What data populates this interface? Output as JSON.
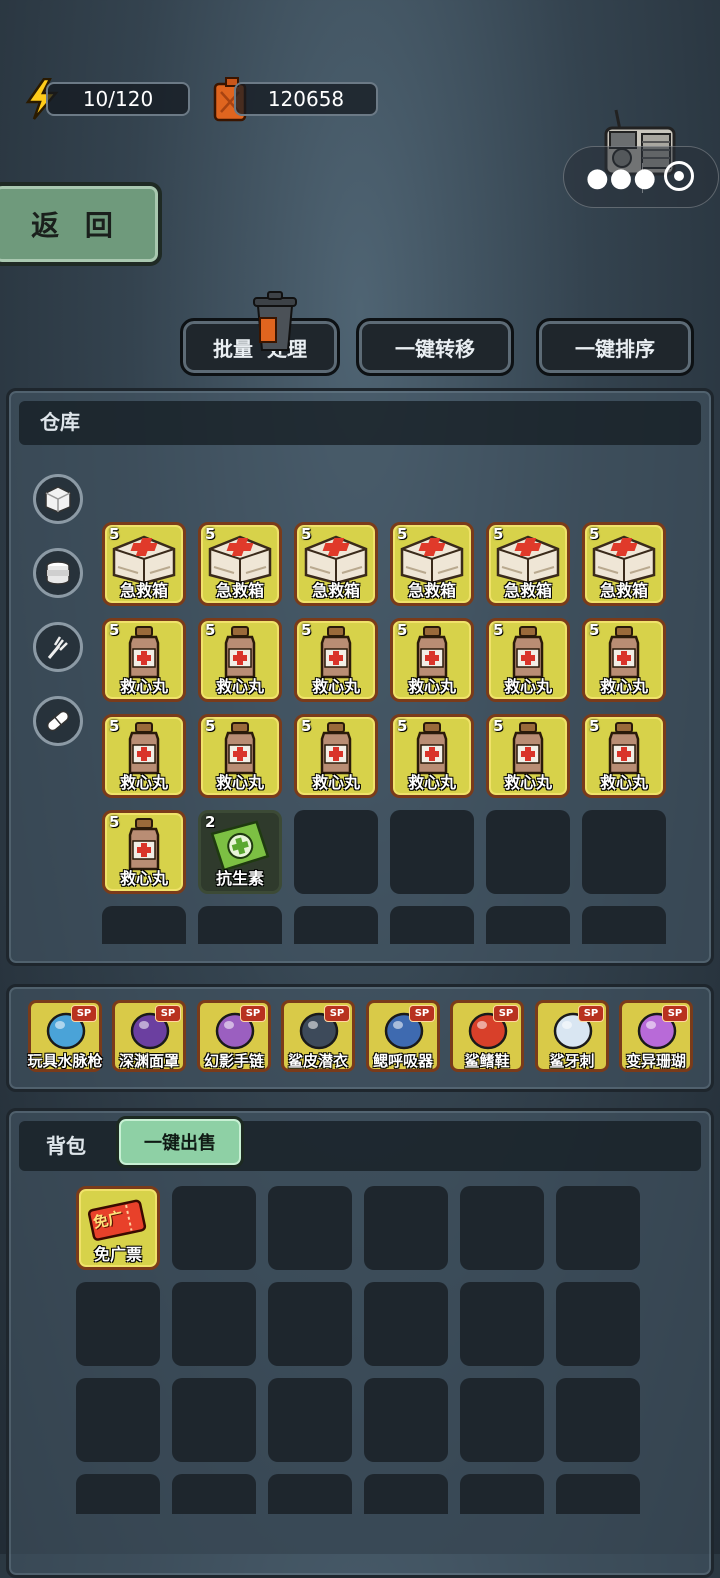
{
  "resources": {
    "energy": {
      "icon": "lightning-icon",
      "value": "10/120"
    },
    "fuel": {
      "icon": "fuel-can-icon",
      "value": "120658"
    }
  },
  "top_right": {
    "radio_icon": "radio-icon",
    "menu_icon": "more-dots-icon",
    "close_icon": "target-circle-icon"
  },
  "back_label": "返 回",
  "actions": {
    "batch_label": "批量  处理",
    "transfer_label": "一键转移",
    "sort_label": "一键排序"
  },
  "warehouse": {
    "title": "仓库",
    "categories": [
      "box-icon",
      "can-icon",
      "fork-icon",
      "pill-icon"
    ],
    "items": [
      {
        "name": "急救箱",
        "qty": "5",
        "icon": "first-aid-kit-icon"
      },
      {
        "name": "急救箱",
        "qty": "5",
        "icon": "first-aid-kit-icon"
      },
      {
        "name": "急救箱",
        "qty": "5",
        "icon": "first-aid-kit-icon"
      },
      {
        "name": "急救箱",
        "qty": "5",
        "icon": "first-aid-kit-icon"
      },
      {
        "name": "急救箱",
        "qty": "5",
        "icon": "first-aid-kit-icon"
      },
      {
        "name": "急救箱",
        "qty": "5",
        "icon": "first-aid-kit-icon"
      },
      {
        "name": "救心丸",
        "qty": "5",
        "icon": "medicine-bottle-icon"
      },
      {
        "name": "救心丸",
        "qty": "5",
        "icon": "medicine-bottle-icon"
      },
      {
        "name": "救心丸",
        "qty": "5",
        "icon": "medicine-bottle-icon"
      },
      {
        "name": "救心丸",
        "qty": "5",
        "icon": "medicine-bottle-icon"
      },
      {
        "name": "救心丸",
        "qty": "5",
        "icon": "medicine-bottle-icon"
      },
      {
        "name": "救心丸",
        "qty": "5",
        "icon": "medicine-bottle-icon"
      },
      {
        "name": "救心丸",
        "qty": "5",
        "icon": "medicine-bottle-icon"
      },
      {
        "name": "救心丸",
        "qty": "5",
        "icon": "medicine-bottle-icon"
      },
      {
        "name": "救心丸",
        "qty": "5",
        "icon": "medicine-bottle-icon"
      },
      {
        "name": "救心丸",
        "qty": "5",
        "icon": "medicine-bottle-icon"
      },
      {
        "name": "救心丸",
        "qty": "5",
        "icon": "medicine-bottle-icon"
      },
      {
        "name": "救心丸",
        "qty": "5",
        "icon": "medicine-bottle-icon"
      },
      {
        "name": "救心丸",
        "qty": "5",
        "icon": "medicine-bottle-icon"
      },
      {
        "name": "抗生素",
        "qty": "2",
        "icon": "antibiotic-pack-icon"
      }
    ]
  },
  "equipment": [
    {
      "name": "玩具水脉枪",
      "badge": "SP",
      "icon": "water-gun-icon"
    },
    {
      "name": "深渊面罩",
      "badge": "SP",
      "icon": "abyss-mask-icon"
    },
    {
      "name": "幻影手链",
      "badge": "SP",
      "icon": "bracelet-icon"
    },
    {
      "name": "鲨皮潜衣",
      "badge": "SP",
      "icon": "shark-suit-icon"
    },
    {
      "name": "鳃呼吸器",
      "badge": "SP",
      "icon": "gill-breather-icon"
    },
    {
      "name": "鲨鳍鞋",
      "badge": "SP",
      "icon": "fin-shoes-icon"
    },
    {
      "name": "鲨牙刺",
      "badge": "SP",
      "icon": "shark-tooth-icon"
    },
    {
      "name": "变异珊瑚",
      "badge": "SP",
      "icon": "coral-icon"
    }
  ],
  "backpack": {
    "title": "背包",
    "sell_label": "一键出售",
    "items": [
      {
        "name": "免广票",
        "ticket_text": "免广",
        "icon": "ad-free-ticket-icon"
      }
    ]
  }
}
